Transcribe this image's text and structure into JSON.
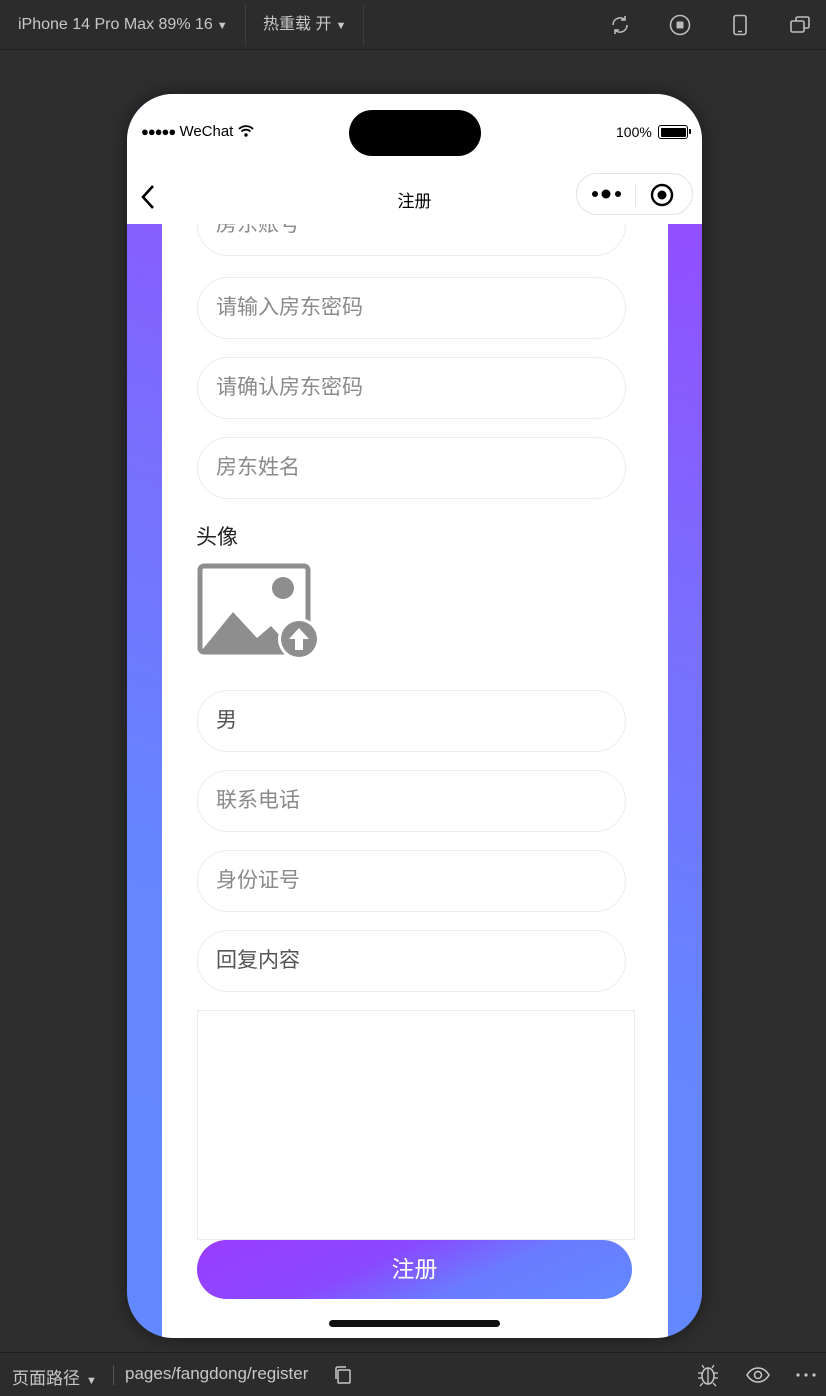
{
  "toolbar": {
    "device": "iPhone 14 Pro Max 89% 16",
    "hot_reload": "热重载 开"
  },
  "status_bar": {
    "carrier": "WeChat",
    "battery": "100%"
  },
  "nav": {
    "title": "注册"
  },
  "form": {
    "account_placeholder": "房东账号",
    "password_placeholder": "请输入房东密码",
    "confirm_placeholder": "请确认房东密码",
    "name_placeholder": "房东姓名",
    "avatar_label": "头像",
    "gender_value": "男",
    "phone_placeholder": "联系电话",
    "id_placeholder": "身份证号",
    "reply_value": "回复内容",
    "submit_label": "注册"
  },
  "bottom_bar": {
    "path_label": "页面路径",
    "path": "pages/fangdong/register"
  },
  "colors": {
    "gradient_top": "#9a44ff",
    "gradient_bottom": "#6289ff",
    "button_start": "#9b3cff",
    "button_end": "#6289ff"
  }
}
